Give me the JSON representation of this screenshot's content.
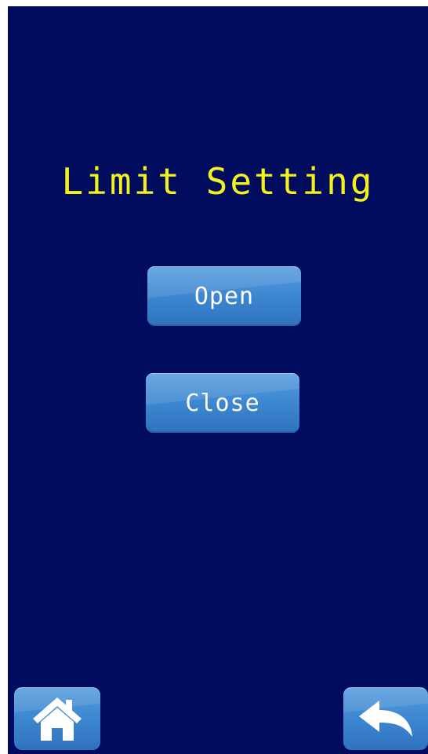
{
  "screen": {
    "title": "Limit Setting",
    "background_color": "#010c5e",
    "title_color": "#f4f21c"
  },
  "buttons": {
    "open_label": "Open",
    "close_label": "Close",
    "button_color": "#3f88d2"
  },
  "nav": {
    "home_icon": "home-icon",
    "back_icon": "back-arrow-icon"
  }
}
